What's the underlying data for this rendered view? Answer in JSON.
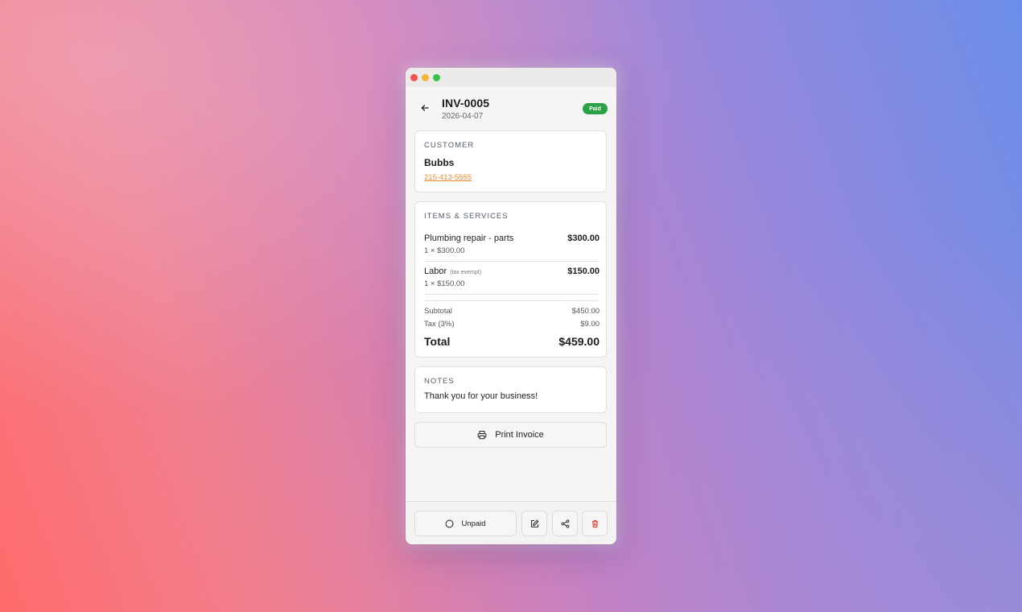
{
  "window": {
    "traffic_lights": [
      "close",
      "minimize",
      "maximize"
    ]
  },
  "header": {
    "back_icon": "arrow-left-icon",
    "invoice_number": "INV-0005",
    "date": "2026-04-07",
    "status_badge": "Paid",
    "status_color": "#2aa047"
  },
  "customer": {
    "section_label": "CUSTOMER",
    "name": "Bubbs",
    "phone": "215-413-5555",
    "phone_color": "#e88a2e"
  },
  "items": {
    "section_label": "ITEMS & SERVICES",
    "list": [
      {
        "name": "Plumbing repair - parts",
        "note": "",
        "qty_line": "1 × $300.00",
        "amount": "$300.00"
      },
      {
        "name": "Labor",
        "note": "(tax exempt)",
        "qty_line": "1 × $150.00",
        "amount": "$150.00"
      }
    ],
    "subtotal_label": "Subtotal",
    "subtotal_value": "$450.00",
    "tax_label": "Tax (3%)",
    "tax_value": "$9.00",
    "total_label": "Total",
    "total_value": "$459.00"
  },
  "notes": {
    "section_label": "NOTES",
    "text": "Thank you for your business!"
  },
  "actions": {
    "print_label": "Print Invoice",
    "print_icon": "printer-icon",
    "unpaid_label": "Unpaid",
    "unpaid_icon": "circle-icon",
    "edit_icon": "edit-icon",
    "share_icon": "share-icon",
    "delete_icon": "trash-icon",
    "delete_color": "#e0403a"
  }
}
